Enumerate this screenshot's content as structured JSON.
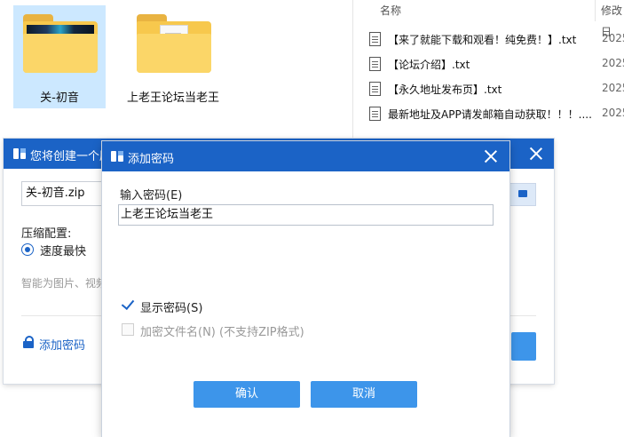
{
  "explorer": {
    "folders": [
      {
        "name": "关-初音",
        "selected": true,
        "icon": "folder-with-image-thumbnail"
      },
      {
        "name": "上老王论坛当老王",
        "selected": false,
        "icon": "folder-with-document"
      }
    ],
    "columns": {
      "name": "名称",
      "modified": "修改日"
    },
    "files": [
      {
        "name": "【来了就能下载和观看！纯免费！】.txt",
        "date": "2025"
      },
      {
        "name": "【论坛介绍】.txt",
        "date": "2025"
      },
      {
        "name": "【永久地址发布页】.txt",
        "date": "2025"
      },
      {
        "name": "最新地址及APP请发邮箱自动获取！！！....",
        "date": "2025"
      }
    ]
  },
  "create_dialog": {
    "title": "您将创建一个压",
    "filename": "关-初音.zip",
    "config_label": "压缩配置:",
    "option_selected": "速度最快",
    "hint": "智能为图片、视频",
    "add_password_link": "添加密码"
  },
  "password_dialog": {
    "title": "添加密码",
    "input_label": "输入密码(E)",
    "password_value": "上老王论坛当老王",
    "show_password": {
      "label": "显示密码(S)",
      "checked": true
    },
    "encrypt_filenames": {
      "label": "加密文件名(N) (不支持ZIP格式)",
      "checked": false,
      "disabled": true
    },
    "ok_label": "确认",
    "cancel_label": "取消"
  },
  "colors": {
    "accent": "#1b63c6",
    "button": "#3d95ea",
    "selection": "#cce8ff",
    "folder": "#f7c84d"
  }
}
